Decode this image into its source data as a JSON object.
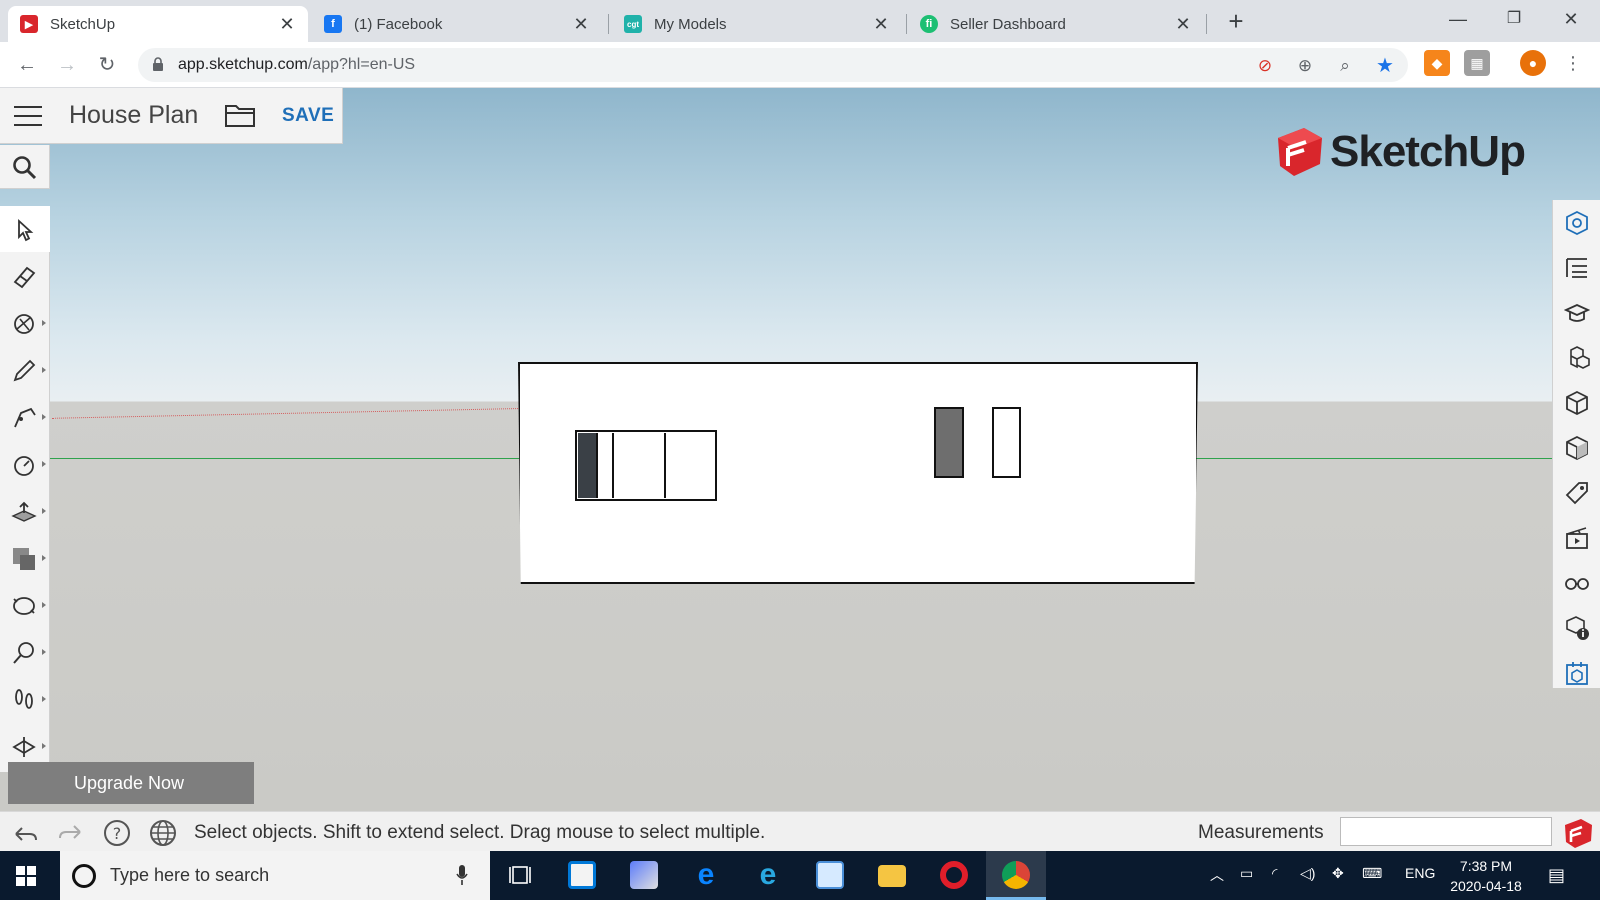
{
  "browser": {
    "tabs": [
      {
        "title": "SketchUp",
        "active": true,
        "favicon": "sketchup-favicon",
        "color": "#d9262c"
      },
      {
        "title": "(1) Facebook",
        "active": false,
        "favicon": "facebook-favicon",
        "color": "#1877f2"
      },
      {
        "title": "My Models",
        "active": false,
        "favicon": "cgtrader-favicon",
        "color": "#20b2aa"
      },
      {
        "title": "Seller Dashboard",
        "active": false,
        "favicon": "fiverr-favicon",
        "color": "#1dbf73"
      }
    ],
    "new_tab_glyph": "+",
    "url_host": "app.sketchup.com",
    "url_path": "/app?hl=en-US"
  },
  "app": {
    "document_title": "House Plan",
    "save_label": "SAVE",
    "brand": "SketchUp",
    "upgrade_label": "Upgrade Now",
    "left_tools": [
      "select-icon",
      "eraser-icon",
      "paint-bucket-icon",
      "pencil-icon",
      "arc-icon",
      "circle-tape-icon",
      "push-pull-icon",
      "offset-icon",
      "orbit-icon",
      "position-camera-icon",
      "walk-icon",
      "section-icon"
    ],
    "right_panels": [
      "entity-info-icon",
      "outliner-icon",
      "instructor-icon",
      "components-icon",
      "materials-icon",
      "styles-icon",
      "tags-icon",
      "scenes-icon",
      "display-icon",
      "model-info-icon",
      "3d-warehouse-icon"
    ],
    "status_text": "Select objects. Shift to extend select. Drag mouse to select multiple.",
    "measurements_label": "Measurements",
    "measurements_value": ""
  },
  "colors": {
    "accent_save": "#1f6fb8",
    "brand_red": "#d9262c",
    "green_axis": "#2fa24c",
    "red_axis": "#d46060"
  },
  "taskbar": {
    "search_placeholder": "Type here to search",
    "language": "ENG",
    "time": "7:38 PM",
    "date": "2020-04-18"
  }
}
